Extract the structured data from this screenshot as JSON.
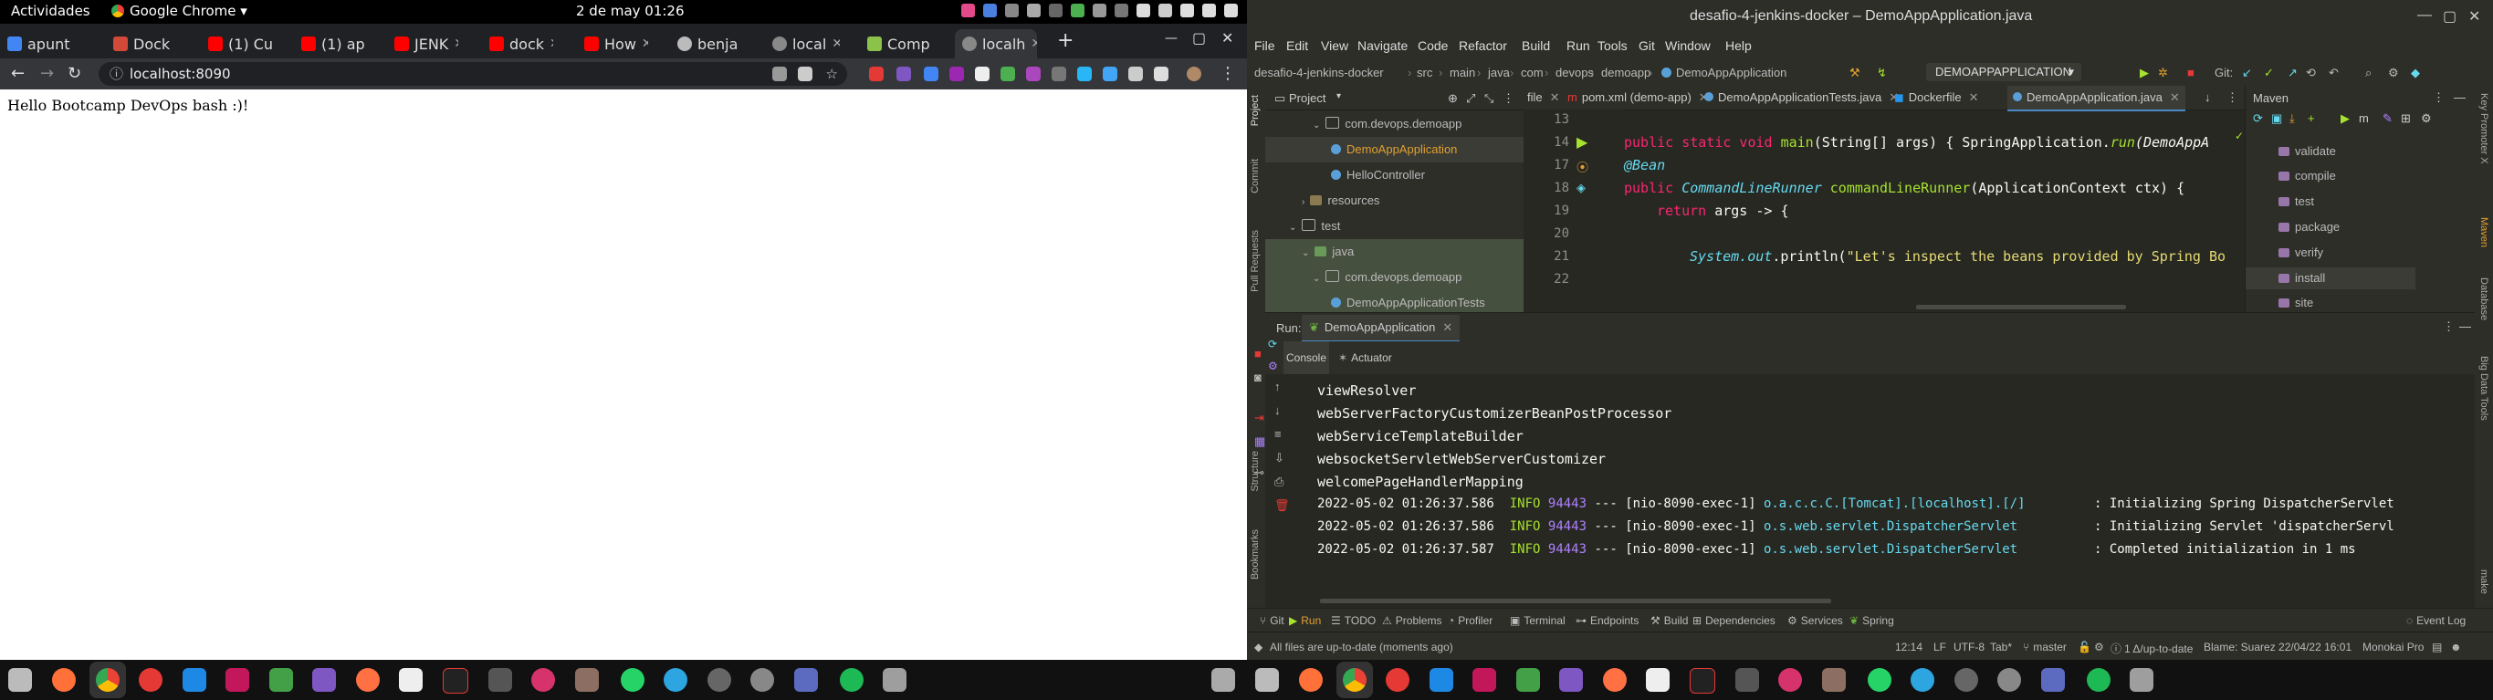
{
  "topbar": {
    "activities": "Actividades",
    "app_menu": "Google Chrome",
    "clock": "2 de may  01:26"
  },
  "chrome": {
    "tabs": [
      "apunt",
      "Dock",
      "(1) Cu",
      "(1) ap",
      "JENK",
      "dock",
      "How",
      "benja",
      "local",
      "Comp",
      "localh"
    ],
    "url": "localhost:8090",
    "new_tab": "+"
  },
  "page": {
    "content": "Hello Bootcamp DevOps bash :)!"
  },
  "ide": {
    "title": "desafio-4-jenkins-docker – DemoAppApplication.java",
    "menu": [
      "File",
      "Edit",
      "View",
      "Navigate",
      "Code",
      "Refactor",
      "Build",
      "Run",
      "Tools",
      "Git",
      "Window",
      "Help"
    ],
    "breadcrumb": [
      "desafio-4-jenkins-docker",
      "src",
      "main",
      "java",
      "com",
      "devops",
      "demoapp",
      "DemoAppApplication"
    ],
    "run_config": "DEMOAPPAPPLICATION",
    "git_label": "Git:",
    "project_panel": {
      "title": "Project",
      "tree": [
        "com.devops.demoapp",
        "DemoAppApplication",
        "HelloController",
        "resources",
        "test",
        "java",
        "com.devops.demoapp",
        "DemoAppApplicationTests"
      ]
    },
    "editor_tabs": [
      "file",
      "pom.xml (demo-app)",
      "DemoAppApplicationTests.java",
      "Dockerfile",
      "DemoAppApplication.java"
    ],
    "line_numbers": [
      "13",
      "14",
      "17",
      "18",
      "19",
      "20",
      "21",
      "22"
    ],
    "code": {
      "l14_a": "public static void ",
      "l14_b": "main",
      "l14_c": "(String[] args) { SpringApplication.",
      "l14_d": "run",
      "l14_e": "(DemoAppA",
      "l17": "@Bean",
      "l18_a": "public ",
      "l18_b": "CommandLineRunner ",
      "l18_c": "commandLineRunner",
      "l18_d": "(ApplicationContext ctx) {",
      "l19_a": "return ",
      "l19_b": "args -> {",
      "l21_a": "System.",
      "l21_b": "out",
      "l21_c": ".println(",
      "l21_d": "\"Let's inspect the beans provided by Spring Bo"
    },
    "maven": {
      "title": "Maven",
      "goals": [
        "validate",
        "compile",
        "test",
        "package",
        "verify",
        "install",
        "site"
      ]
    },
    "run": {
      "label": "Run:",
      "tab": "DemoAppApplication",
      "subtabs": [
        "Console",
        "Actuator"
      ]
    },
    "console": [
      "viewResolver",
      "webServerFactoryCustomizerBeanPostProcessor",
      "webServiceTemplateBuilder",
      "websocketServletWebServerCustomizer",
      "welcomePageHandlerMapping"
    ],
    "logs": [
      {
        "ts": "2022-05-02 01:26:37.586",
        "level": "INFO",
        "pid": "94443",
        "sep": "---",
        "thread": "[nio-8090-exec-1]",
        "logger": "o.a.c.c.C.[Tomcat].[localhost].[/]",
        "msg": ": Initializing Spring DispatcherServlet"
      },
      {
        "ts": "2022-05-02 01:26:37.586",
        "level": "INFO",
        "pid": "94443",
        "sep": "---",
        "thread": "[nio-8090-exec-1]",
        "logger": "o.s.web.servlet.DispatcherServlet",
        "msg": ": Initializing Servlet 'dispatcherServl"
      },
      {
        "ts": "2022-05-02 01:26:37.587",
        "level": "INFO",
        "pid": "94443",
        "sep": "---",
        "thread": "[nio-8090-exec-1]",
        "logger": "o.s.web.servlet.DispatcherServlet",
        "msg": ": Completed initialization in 1 ms"
      }
    ],
    "left_strip": [
      "Project",
      "Commit",
      "Pull Requests",
      "Structure",
      "Bookmarks"
    ],
    "right_strip": [
      "Key Promoter X",
      "Maven",
      "Database",
      "Big Data Tools",
      "make"
    ],
    "toolwindows": [
      "Git",
      "Run",
      "TODO",
      "Problems",
      "Profiler",
      "Terminal",
      "Endpoints",
      "Build",
      "Dependencies",
      "Services",
      "Spring",
      "Event Log"
    ],
    "status": {
      "message": "All files are up-to-date (moments ago)",
      "position": "12:14",
      "line_sep": "LF",
      "encoding": "UTF-8",
      "indent": "Tab*",
      "branch": "master",
      "git_status": "1 Δ/up-to-date",
      "blame": "Blame: Suarez 22/04/22 16:01",
      "theme": "Monokai Pro"
    }
  },
  "colors": {
    "editor_bg": "#272822",
    "panel_bg": "#2d2e28",
    "keyword": "#f92672",
    "type": "#66d9ef",
    "function": "#a6e22e",
    "string": "#e6db74",
    "log_pid": "#ae81ff",
    "log_logger": "#66d9ef",
    "log_info": "#a6e22e"
  }
}
